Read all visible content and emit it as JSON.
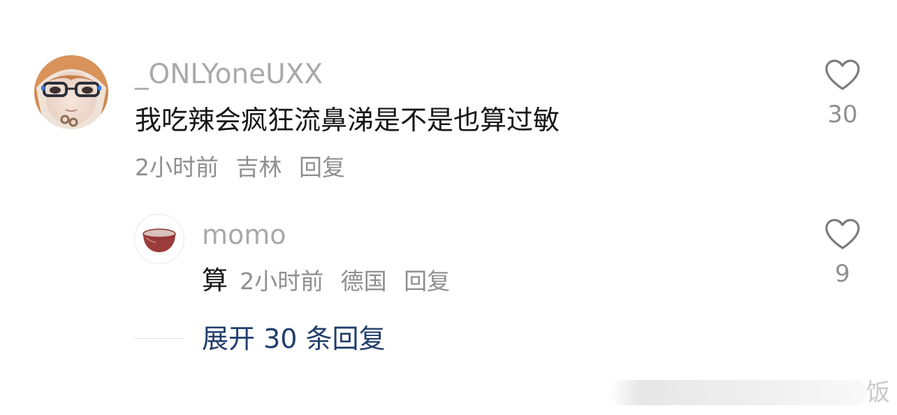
{
  "comment": {
    "author": "_ONLYoneUXX",
    "text": "我吃辣会疯狂流鼻涕是不是也算过敏",
    "time": "2小时前",
    "location": "吉林",
    "reply_label": "回复",
    "like_count": "30",
    "like_icon": "heart-outline-icon"
  },
  "reply": {
    "author": "momo",
    "text": "算",
    "time": "2小时前",
    "location": "德国",
    "reply_label": "回复",
    "like_count": "9",
    "like_icon": "heart-outline-icon"
  },
  "expand": {
    "label": "展开 30 条回复"
  },
  "watermark": {
    "text": "饭"
  },
  "colors": {
    "username": "#a9a9a9",
    "body_text": "#161616",
    "meta": "#8f8f8f",
    "link": "#213e6b"
  }
}
